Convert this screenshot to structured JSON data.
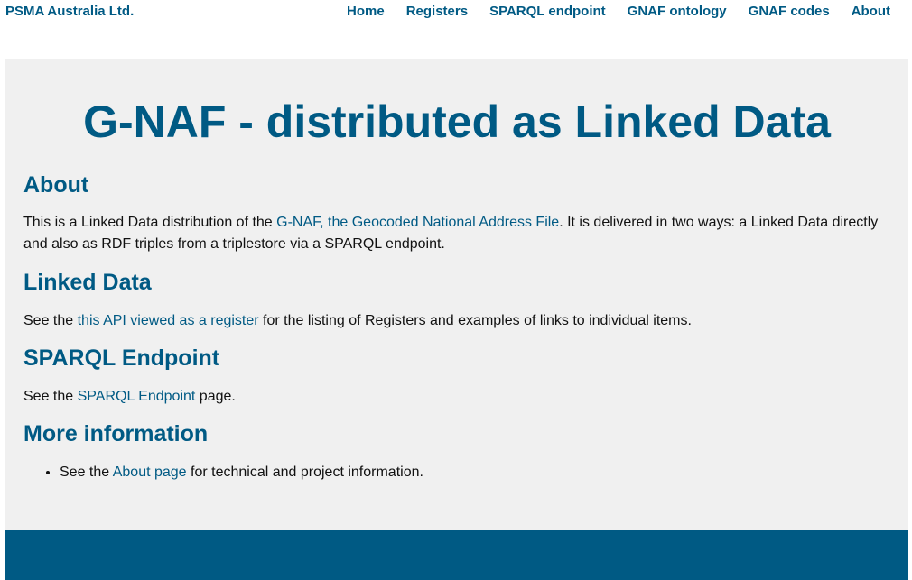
{
  "header": {
    "brand": "PSMA Australia Ltd.",
    "nav": {
      "home": "Home",
      "registers": "Registers",
      "sparql": "SPARQL endpoint",
      "ontology": "GNAF ontology",
      "codes": "GNAF codes",
      "about": "About"
    }
  },
  "main": {
    "title": "G-NAF - distributed as Linked Data",
    "about": {
      "heading": "About",
      "text_before": "This is a Linked Data distribution of the ",
      "link": "G-NAF, the Geocoded National Address File",
      "text_after": ". It is delivered in two ways: a Linked Data directly and also as RDF triples from a triplestore via a SPARQL endpoint."
    },
    "linked_data": {
      "heading": "Linked Data",
      "text_before": "See the ",
      "link": "this API viewed as a register",
      "text_after": " for the listing of Registers and examples of links to individual items."
    },
    "sparql": {
      "heading": "SPARQL Endpoint",
      "text_before": "See the ",
      "link": "SPARQL Endpoint",
      "text_after": " page."
    },
    "more_info": {
      "heading": "More information",
      "items": [
        {
          "text_before": "See the ",
          "link": "About page",
          "text_after": " for technical and project information."
        }
      ]
    }
  },
  "colors": {
    "accent": "#005a84",
    "panel": "#f0f0f0",
    "text": "#111111"
  }
}
